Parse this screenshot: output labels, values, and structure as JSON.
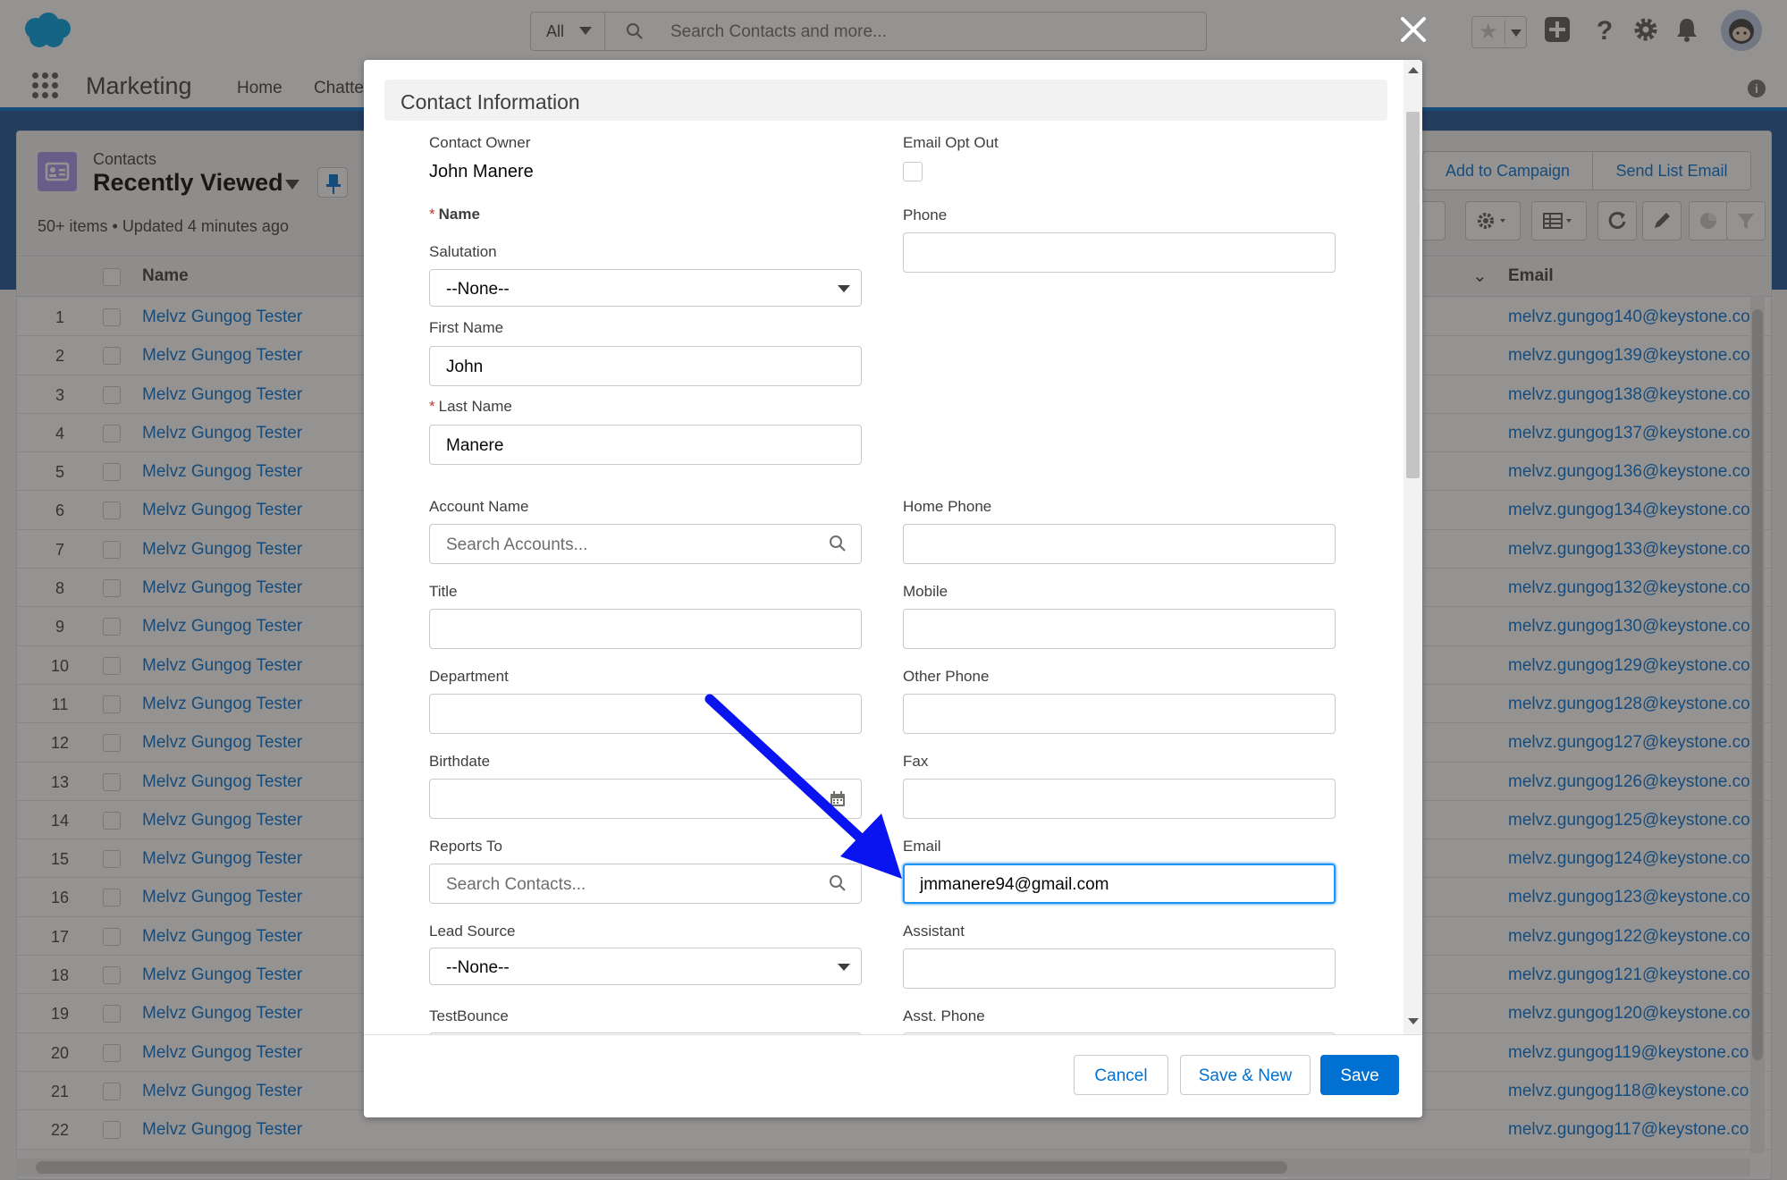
{
  "header": {
    "search_scope": "All",
    "search_placeholder": "Search Contacts and more..."
  },
  "nav": {
    "app_name": "Marketing",
    "items": [
      "Home",
      "Chatte"
    ]
  },
  "list_view": {
    "object_label": "Contacts",
    "view_name": "Recently Viewed",
    "meta": "50+ items • Updated 4 minutes ago",
    "buttons": {
      "add_to_campaign": "Add to Campaign",
      "send_list_email": "Send List Email"
    },
    "columns": {
      "name": "Name",
      "email": "Email"
    },
    "rows": [
      {
        "num": "1",
        "name": "Melvz Gungog Tester",
        "email": "melvz.gungog140@keystone.co"
      },
      {
        "num": "2",
        "name": "Melvz Gungog Tester",
        "email": "melvz.gungog139@keystone.co"
      },
      {
        "num": "3",
        "name": "Melvz Gungog Tester",
        "email": "melvz.gungog138@keystone.co"
      },
      {
        "num": "4",
        "name": "Melvz Gungog Tester",
        "email": "melvz.gungog137@keystone.co"
      },
      {
        "num": "5",
        "name": "Melvz Gungog Tester",
        "email": "melvz.gungog136@keystone.co"
      },
      {
        "num": "6",
        "name": "Melvz Gungog Tester",
        "email": "melvz.gungog134@keystone.co"
      },
      {
        "num": "7",
        "name": "Melvz Gungog Tester",
        "email": "melvz.gungog133@keystone.co"
      },
      {
        "num": "8",
        "name": "Melvz Gungog Tester",
        "email": "melvz.gungog132@keystone.co"
      },
      {
        "num": "9",
        "name": "Melvz Gungog Tester",
        "email": "melvz.gungog130@keystone.co"
      },
      {
        "num": "10",
        "name": "Melvz Gungog Tester",
        "email": "melvz.gungog129@keystone.co"
      },
      {
        "num": "11",
        "name": "Melvz Gungog Tester",
        "email": "melvz.gungog128@keystone.co"
      },
      {
        "num": "12",
        "name": "Melvz Gungog Tester",
        "email": "melvz.gungog127@keystone.co"
      },
      {
        "num": "13",
        "name": "Melvz Gungog Tester",
        "email": "melvz.gungog126@keystone.co"
      },
      {
        "num": "14",
        "name": "Melvz Gungog Tester",
        "email": "melvz.gungog125@keystone.co"
      },
      {
        "num": "15",
        "name": "Melvz Gungog Tester",
        "email": "melvz.gungog124@keystone.co"
      },
      {
        "num": "16",
        "name": "Melvz Gungog Tester",
        "email": "melvz.gungog123@keystone.co"
      },
      {
        "num": "17",
        "name": "Melvz Gungog Tester",
        "email": "melvz.gungog122@keystone.co"
      },
      {
        "num": "18",
        "name": "Melvz Gungog Tester",
        "email": "melvz.gungog121@keystone.co"
      },
      {
        "num": "19",
        "name": "Melvz Gungog Tester",
        "email": "melvz.gungog120@keystone.co"
      },
      {
        "num": "20",
        "name": "Melvz Gungog Tester",
        "email": "melvz.gungog119@keystone.co"
      },
      {
        "num": "21",
        "name": "Melvz Gungog Tester",
        "email": "melvz.gungog118@keystone.co"
      },
      {
        "num": "22",
        "name": "Melvz Gungog Tester",
        "email": "melvz.gungog117@keystone.co"
      }
    ]
  },
  "modal": {
    "section_title": "Contact Information",
    "contact_owner": {
      "label": "Contact Owner",
      "value": "John Manere"
    },
    "email_opt_out": {
      "label": "Email Opt Out",
      "checked": false
    },
    "name_label": "Name",
    "required_mark": "*",
    "salutation": {
      "label": "Salutation",
      "value": "--None--"
    },
    "first_name": {
      "label": "First Name",
      "value": "John"
    },
    "last_name": {
      "label": "Last Name",
      "value": "Manere"
    },
    "phone": {
      "label": "Phone",
      "value": ""
    },
    "account_name": {
      "label": "Account Name",
      "placeholder": "Search Accounts..."
    },
    "home_phone": {
      "label": "Home Phone",
      "value": ""
    },
    "title": {
      "label": "Title",
      "value": ""
    },
    "mobile": {
      "label": "Mobile",
      "value": ""
    },
    "department": {
      "label": "Department",
      "value": ""
    },
    "other_phone": {
      "label": "Other Phone",
      "value": ""
    },
    "birthdate": {
      "label": "Birthdate",
      "value": ""
    },
    "fax": {
      "label": "Fax",
      "value": ""
    },
    "reports_to": {
      "label": "Reports To",
      "placeholder": "Search Contacts..."
    },
    "email": {
      "label": "Email",
      "value": "jmmanere94@gmail.com"
    },
    "lead_source": {
      "label": "Lead Source",
      "value": "--None--"
    },
    "assistant": {
      "label": "Assistant",
      "value": ""
    },
    "test_bounce": {
      "label": "TestBounce"
    },
    "asst_phone": {
      "label": "Asst. Phone"
    },
    "footer": {
      "cancel": "Cancel",
      "save_new": "Save & New",
      "save": "Save"
    }
  },
  "colors": {
    "brand_blue": "#0070d2",
    "link_blue": "#0070d2",
    "focus_blue": "#1b96ff",
    "annotation_arrow": "#0a14f0",
    "required_red": "#c23934"
  }
}
